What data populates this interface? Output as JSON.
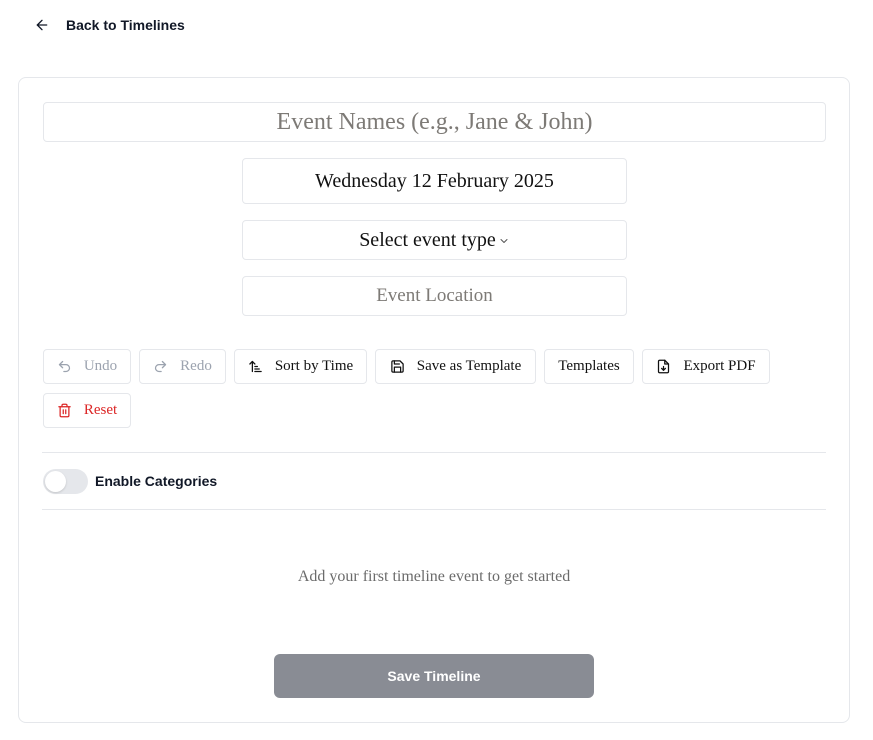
{
  "header": {
    "back_label": "Back to Timelines"
  },
  "form": {
    "event_names_placeholder": "Event Names (e.g., Jane & John)",
    "date_value": "Wednesday 12 February 2025",
    "event_type_label": "Select event type",
    "location_placeholder": "Event Location"
  },
  "toolbar": {
    "undo_label": "Undo",
    "redo_label": "Redo",
    "sort_label": "Sort by Time",
    "save_template_label": "Save as Template",
    "templates_label": "Templates",
    "export_label": "Export PDF",
    "reset_label": "Reset"
  },
  "categories": {
    "toggle_label": "Enable Categories",
    "enabled": false
  },
  "timeline": {
    "empty_message": "Add your first timeline event to get started"
  },
  "footer": {
    "save_label": "Save Timeline"
  },
  "colors": {
    "danger": "#dc2626",
    "save_button_bg": "#898c94",
    "border": "#e5e7eb"
  }
}
